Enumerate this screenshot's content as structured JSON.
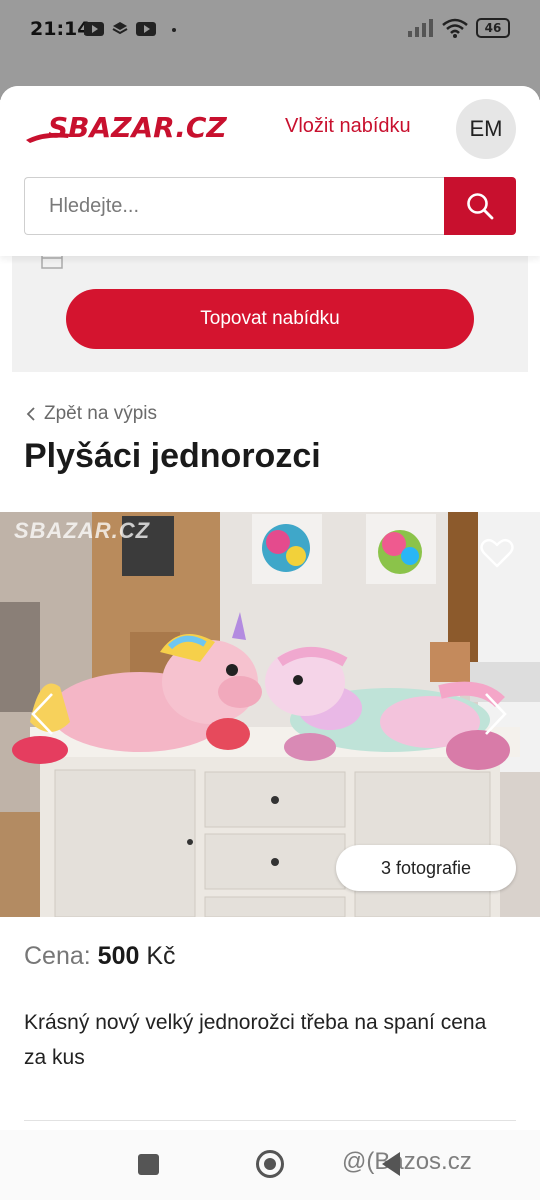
{
  "status_bar": {
    "time": "21:14",
    "battery": "46",
    "icons": [
      "youtube-icon",
      "stack-icon",
      "youtube-icon",
      "dot-icon",
      "signal-icon",
      "wifi-icon",
      "battery-icon"
    ]
  },
  "header": {
    "logo_text": "SBAZAR.CZ",
    "post_offer_label": "Vložit nabídku",
    "avatar_initials": "EM"
  },
  "search": {
    "placeholder": "Hledejte...",
    "value": ""
  },
  "promo": {
    "top_button_label": "Topovat nabídku"
  },
  "listing": {
    "back_label": "Zpět na výpis",
    "title": "Plyšáci jednorozci",
    "photo_watermark": "SBAZAR.CZ",
    "photo_count_label": "3 fotografie",
    "price_label": "Cena:",
    "price_value": "500",
    "price_currency": "Kč",
    "description": "Krásný nový velký jednorožci třeba na spaní cena za kus"
  },
  "footer": {
    "watermark": "@(Bazos.cz"
  },
  "colors": {
    "brand_red": "#c8102e",
    "button_red": "#d4142f"
  }
}
